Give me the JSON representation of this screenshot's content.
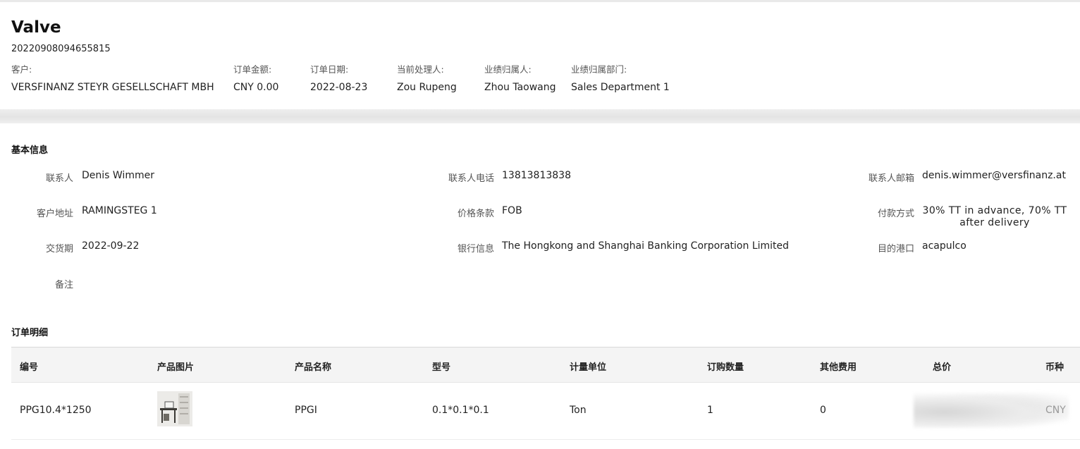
{
  "header": {
    "title": "Valve",
    "order_number": "20220908094655815",
    "fields": [
      {
        "label": "客户:",
        "value": "VERSFINANZ STEYR GESELLSCHAFT MBH"
      },
      {
        "label": "订单金额:",
        "value": "CNY 0.00"
      },
      {
        "label": "订单日期:",
        "value": "2022-08-23"
      },
      {
        "label": "当前处理人:",
        "value": "Zou Rupeng"
      },
      {
        "label": "业绩归属人:",
        "value": "Zhou Taowang"
      },
      {
        "label": "业绩归属部门:",
        "value": "Sales Department 1"
      }
    ]
  },
  "basic_info": {
    "section_title": "基本信息",
    "contact": {
      "label": "联系人",
      "value": "Denis Wimmer"
    },
    "contact_phone": {
      "label": "联系人电话",
      "value": "13813813838"
    },
    "contact_email": {
      "label": "联系人邮箱",
      "value": "denis.wimmer@versfinanz.at"
    },
    "customer_address": {
      "label": "客户地址",
      "value": "RAMINGSTEG 1"
    },
    "price_terms": {
      "label": "价格条款",
      "value": "FOB"
    },
    "payment_method": {
      "label": "付款方式",
      "value": "30% TT in advance, 70% TT after delivery"
    },
    "delivery_date": {
      "label": "交货期",
      "value": "2022-09-22"
    },
    "bank_info": {
      "label": "银行信息",
      "value": "The Hongkong and Shanghai Banking Corporation Limited"
    },
    "destination_port": {
      "label": "目的港口",
      "value": "acapulco"
    },
    "remarks": {
      "label": "备注",
      "value": ""
    }
  },
  "order_details": {
    "section_title": "订单明细",
    "columns": [
      "编号",
      "产品图片",
      "产品名称",
      "型号",
      "计量单位",
      "订购数量",
      "其他费用",
      "总价",
      "币种"
    ],
    "rows": [
      {
        "code": "PPG10.4*1250",
        "image": "product-photo",
        "name": "PPGI",
        "model": "0.1*0.1*0.1",
        "unit": "Ton",
        "quantity": "1",
        "other_fees": "0",
        "total": "",
        "currency": "CNY"
      }
    ]
  }
}
